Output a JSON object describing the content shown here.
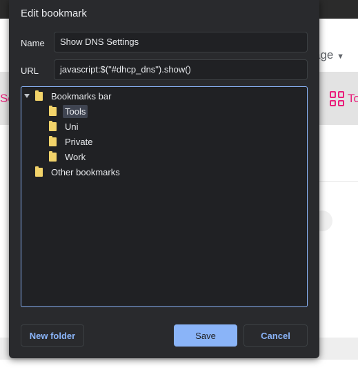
{
  "background": {
    "language_label": "age",
    "left_link_text": "Se",
    "tools_label": "To"
  },
  "dialog": {
    "title": "Edit bookmark",
    "name_label": "Name",
    "name_value": "Show DNS Settings",
    "url_label": "URL",
    "url_value": "javascript:$(\"#dhcp_dns\").show()",
    "tree": {
      "root": "Bookmarks bar",
      "children": [
        "Tools",
        "Uni",
        "Private",
        "Work"
      ],
      "selected": "Tools",
      "other": "Other bookmarks"
    },
    "buttons": {
      "new_folder": "New folder",
      "save": "Save",
      "cancel": "Cancel"
    }
  },
  "colors": {
    "accent": "#8ab4f8",
    "dialog_bg": "#292a2d",
    "folder": "#f2d36a",
    "brand_pink": "#e91e7a"
  }
}
